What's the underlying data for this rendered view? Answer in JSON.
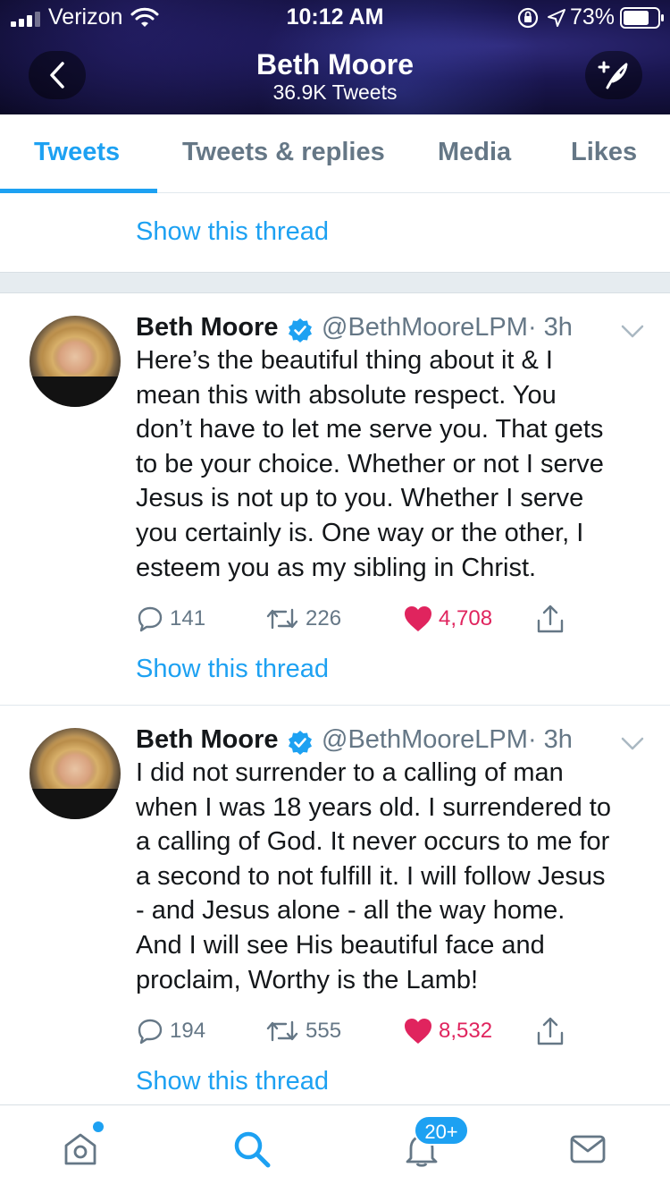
{
  "status_bar": {
    "carrier": "Verizon",
    "time": "10:12 AM",
    "battery_percent": "73%",
    "icons": [
      "signal-icon",
      "wifi-icon",
      "rotation-lock-icon",
      "location-icon",
      "battery-icon"
    ]
  },
  "header": {
    "title": "Beth Moore",
    "subtitle": "36.9K Tweets",
    "back_icon": "chevron-left-icon",
    "compose_icon": "compose-tweet-icon"
  },
  "tabs": [
    {
      "label": "Tweets",
      "active": true
    },
    {
      "label": "Tweets & replies",
      "active": false
    },
    {
      "label": "Media",
      "active": false
    },
    {
      "label": "Likes",
      "active": false
    }
  ],
  "feed": {
    "top_show_thread": "Show this thread",
    "tweets": [
      {
        "name": "Beth Moore",
        "verified": true,
        "handle": "@BethMooreLPM",
        "time": "· 3h",
        "text": "Here’s the beautiful thing about it & I\nmean this with absolute respect. You\ndon’t have to let me serve you. That gets\nto be your choice. Whether or not I serve\nJesus is not up to you. Whether I serve\nyou certainly is. One way or the other, I\nesteem you as my sibling in Christ.",
        "replies": "141",
        "retweets": "226",
        "likes": "4,708",
        "liked": true,
        "show_thread": "Show this thread"
      },
      {
        "name": "Beth Moore",
        "verified": true,
        "handle": "@BethMooreLPM",
        "time": "· 3h",
        "text": "I did not surrender to a calling of man\nwhen I was 18 years old. I surrendered to\na calling of God. It never occurs to me for\na second to not fulfill it. I will follow Jesus\n- and Jesus alone - all the way home.\nAnd  I will see His beautiful face and\nproclaim, Worthy is the Lamb!",
        "replies": "194",
        "retweets": "555",
        "likes": "8,532",
        "liked": true,
        "show_thread": "Show this thread"
      }
    ]
  },
  "bottom_nav": {
    "items": [
      "home-icon",
      "search-icon",
      "notifications-icon",
      "messages-icon"
    ],
    "notification_badge": "20+"
  },
  "colors": {
    "accent": "#1da1f2",
    "like": "#e0245e",
    "secondary_text": "#657786",
    "primary_text": "#14171a"
  }
}
